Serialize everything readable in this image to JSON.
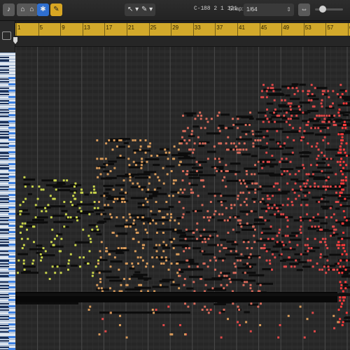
{
  "toolbar": {
    "left_buttons": [
      {
        "name": "midi-in-icon",
        "glyph": "♪"
      },
      {
        "name": "quantize-icon",
        "glyph": "⌂"
      },
      {
        "name": "collapse-icon",
        "glyph": "⌂"
      },
      {
        "name": "midi-draw-icon",
        "glyph": "✱"
      },
      {
        "name": "pencil-icon",
        "glyph": "✎"
      }
    ],
    "pointer_tool": "↖ ▾",
    "pencil_tool": "✎ ▾",
    "note_readout": "C-1",
    "position_readout": "88 2 1 121",
    "snap_label": "Snap:",
    "snap_value": "1/64",
    "accent_yellow": "#d2a92b",
    "accent_blue": "#2f6fd0"
  },
  "ruler": {
    "bars": [
      "1",
      "5",
      "9",
      "13",
      "17",
      "21",
      "25",
      "29",
      "33",
      "37",
      "41",
      "45",
      "49",
      "53",
      "57",
      "61"
    ]
  },
  "note_colors": {
    "section1": "#c9d44a",
    "section2": "#d89a5a",
    "section3": "#d86a5a",
    "section4": "#e04848",
    "section5": "#ff3a3a"
  }
}
